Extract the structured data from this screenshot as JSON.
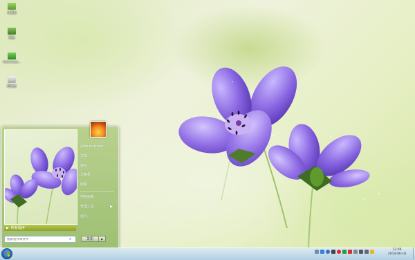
{
  "desktop": {
    "icons": [
      {
        "label": "计算机",
        "icon": "computer-icon",
        "color": "#6aa84f"
      },
      {
        "label": "网络",
        "icon": "network-icon",
        "color": "#4f8f3a"
      },
      {
        "label": "Administr...",
        "icon": "user-folder-icon",
        "color": "#3f9a3a"
      },
      {
        "label": "回收站",
        "icon": "recycle-bin-icon",
        "color": "#c8c8c8"
      }
    ]
  },
  "start_menu": {
    "all_programs": "所有程序",
    "search_placeholder": "搜索程序和文件",
    "user_items": [
      "Administrator",
      "文档",
      "游戏",
      "计算机",
      "网络"
    ],
    "system_items": [
      "控制面板",
      "管理工具",
      "运行..."
    ],
    "shutdown_label": "关机"
  },
  "taskbar": {
    "clock_time": "12:09",
    "clock_date": "2014-06-18"
  },
  "colors": {
    "accent": "#8ea32c",
    "petal": "#8b6fe0"
  }
}
